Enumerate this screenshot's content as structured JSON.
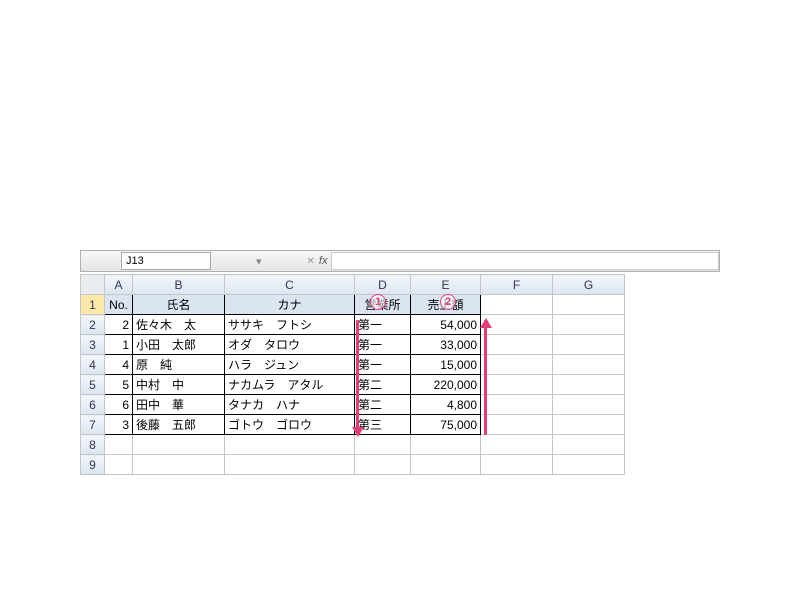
{
  "formula_bar": {
    "name_box": "J13",
    "fx_label": "fx",
    "formula_value": ""
  },
  "column_headers": [
    "A",
    "B",
    "C",
    "D",
    "E",
    "F",
    "G"
  ],
  "row_headers": [
    "1",
    "2",
    "3",
    "4",
    "5",
    "6",
    "7",
    "8",
    "9"
  ],
  "selected_row_header": "1",
  "data_headers": {
    "no": "No.",
    "name": "氏名",
    "kana": "カナ",
    "office": "営業所",
    "sales": "売上額"
  },
  "rows": [
    {
      "no": "2",
      "name": "佐々木　太",
      "kana": "ササキ　フトシ",
      "office": "第一",
      "sales": "54,000"
    },
    {
      "no": "1",
      "name": "小田　太郎",
      "kana": "オダ　タロウ",
      "office": "第一",
      "sales": "33,000"
    },
    {
      "no": "4",
      "name": "原　純",
      "kana": "ハラ　ジュン",
      "office": "第一",
      "sales": "15,000"
    },
    {
      "no": "5",
      "name": "中村　中",
      "kana": "ナカムラ　アタル",
      "office": "第二",
      "sales": "220,000"
    },
    {
      "no": "6",
      "name": "田中　華",
      "kana": "タナカ　ハナ",
      "office": "第二",
      "sales": "4,800"
    },
    {
      "no": "3",
      "name": "後藤　五郎",
      "kana": "ゴトウ　ゴロウ",
      "office": "第三",
      "sales": "75,000"
    }
  ],
  "annotations": {
    "circle1": "1",
    "circle2": "2"
  },
  "chart_data": {
    "type": "table",
    "title": "",
    "columns": [
      "No.",
      "氏名",
      "カナ",
      "営業所",
      "売上額"
    ],
    "rows": [
      [
        2,
        "佐々木　太",
        "ササキ　フトシ",
        "第一",
        54000
      ],
      [
        1,
        "小田　太郎",
        "オダ　タロウ",
        "第一",
        33000
      ],
      [
        4,
        "原　純",
        "ハラ　ジュン",
        "第一",
        15000
      ],
      [
        5,
        "中村　中",
        "ナカムラ　アタル",
        "第二",
        220000
      ],
      [
        6,
        "田中　華",
        "タナカ　ハナ",
        "第二",
        4800
      ],
      [
        3,
        "後藤　五郎",
        "ゴトウ　ゴロウ",
        "第三",
        75000
      ]
    ]
  }
}
